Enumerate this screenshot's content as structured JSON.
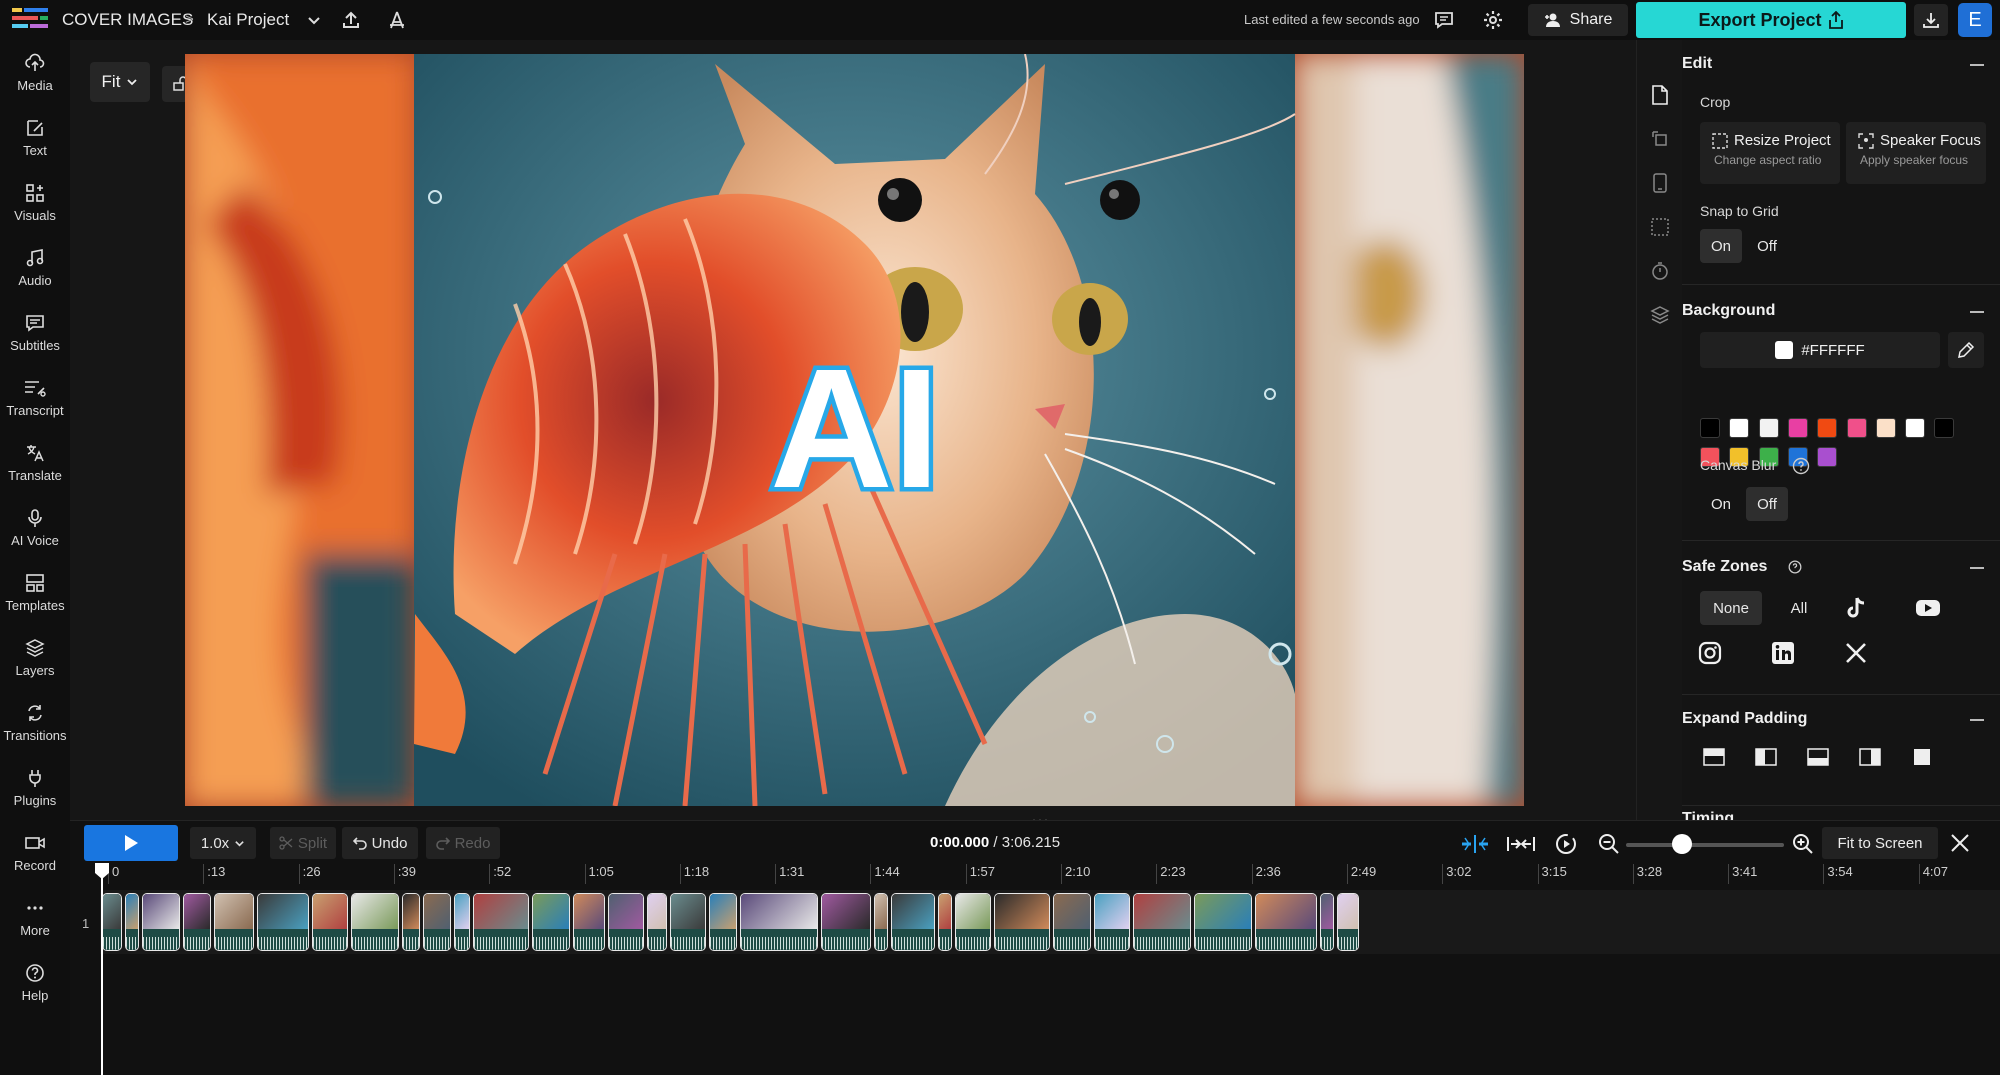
{
  "header": {
    "breadcrumb_root": "COVER IMAGES",
    "project_name": "Kai Project",
    "last_edited": "Last edited a few seconds ago",
    "share_label": "Share",
    "export_label": "Export Project",
    "avatar_initial": "E"
  },
  "sidebar": {
    "items": [
      {
        "label": "Media",
        "icon": "upload-cloud-icon"
      },
      {
        "label": "Text",
        "icon": "text-edit-icon"
      },
      {
        "label": "Visuals",
        "icon": "shapes-icon"
      },
      {
        "label": "Audio",
        "icon": "music-note-icon"
      },
      {
        "label": "Subtitles",
        "icon": "subtitles-icon"
      },
      {
        "label": "Transcript",
        "icon": "transcript-icon"
      },
      {
        "label": "Translate",
        "icon": "translate-icon"
      },
      {
        "label": "AI Voice",
        "icon": "microphone-icon"
      },
      {
        "label": "Templates",
        "icon": "templates-icon"
      },
      {
        "label": "Layers",
        "icon": "layers-icon"
      },
      {
        "label": "Transitions",
        "icon": "transitions-icon"
      },
      {
        "label": "Plugins",
        "icon": "plugin-icon"
      },
      {
        "label": "Record",
        "icon": "camera-icon"
      },
      {
        "label": "More",
        "icon": "more-dots-icon"
      },
      {
        "label": "Help",
        "icon": "help-icon"
      }
    ]
  },
  "canvas": {
    "fit_label": "Fit",
    "overlay_text": "AI"
  },
  "panel": {
    "edit_heading": "Edit",
    "crop_label": "Crop",
    "resize_title": "Resize Project",
    "resize_sub": "Change aspect ratio",
    "speaker_title": "Speaker Focus",
    "speaker_sub": "Apply speaker focus",
    "snap_label": "Snap to Grid",
    "snap_on": "On",
    "snap_off": "Off",
    "background_heading": "Background",
    "background_hex": "#FFFFFF",
    "swatches_row1": [
      "#000000",
      "#ffffff",
      "#f2f2f2",
      "#e83fa3",
      "#f04a12",
      "#f0508a",
      "#fbe0c8",
      "#ffffff",
      "#000000"
    ],
    "swatches_row2": [
      "#f2525c",
      "#f2c02a",
      "#3db04a",
      "#1f73d8",
      "#a94fcf"
    ],
    "blur_label": "Canvas Blur",
    "blur_on": "On",
    "blur_off": "Off",
    "safe_heading": "Safe Zones",
    "safe_none": "None",
    "safe_all": "All",
    "padding_heading": "Expand Padding",
    "timing_heading": "Timing"
  },
  "timeline": {
    "speed": "1.0x",
    "split_label": "Split",
    "undo_label": "Undo",
    "redo_label": "Redo",
    "current_time": "0:00.000",
    "total_time": " / 3:06.215",
    "fit_screen_label": "Fit to Screen",
    "track_number": "1",
    "ticks": [
      "0",
      ":13",
      ":26",
      ":39",
      ":52",
      "1:05",
      "1:18",
      "1:31",
      "1:44",
      "1:57",
      "2:10",
      "2:23",
      "2:36",
      "2:49",
      "3:02",
      "3:15",
      "3:28",
      "3:41",
      "3:54",
      "4:07"
    ]
  },
  "colors": {
    "accent": "#26d7d4",
    "play": "#1976e0",
    "avatar": "#1f6fd6"
  }
}
